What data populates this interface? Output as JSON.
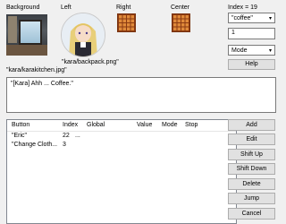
{
  "labels": {
    "background": "Background",
    "left": "Left",
    "right": "Right",
    "center": "Center",
    "index": "Index = 19"
  },
  "left_image_name": "\"kara/backpack.png\"",
  "background_image_name": "\"kara/karakitchen.jpg\"",
  "index_select": {
    "value": "\"coffee\""
  },
  "index_input": {
    "value": "1"
  },
  "mode_select": {
    "value": "Mode"
  },
  "help_button": "Help",
  "dialog_text": "\"[Kara] Ahh ... Coffee.\"",
  "table": {
    "columns": [
      "Button",
      "Index",
      "Global",
      "Value",
      "Mode",
      "Stop"
    ],
    "rows": [
      {
        "button": "\"Eric\"",
        "index": "22",
        "global": "...",
        "value": "",
        "mode": "",
        "stop": ""
      },
      {
        "button": "\"Change Cloth...",
        "index": "3",
        "global": "",
        "value": "",
        "mode": "",
        "stop": ""
      }
    ]
  },
  "side_buttons": [
    "Add",
    "Edit",
    "Shift Up",
    "Shift Down",
    "Delete",
    "Jump",
    "Cancel"
  ],
  "colors": {
    "accent": "#e08a3a",
    "panel": "#f0f0f0"
  }
}
